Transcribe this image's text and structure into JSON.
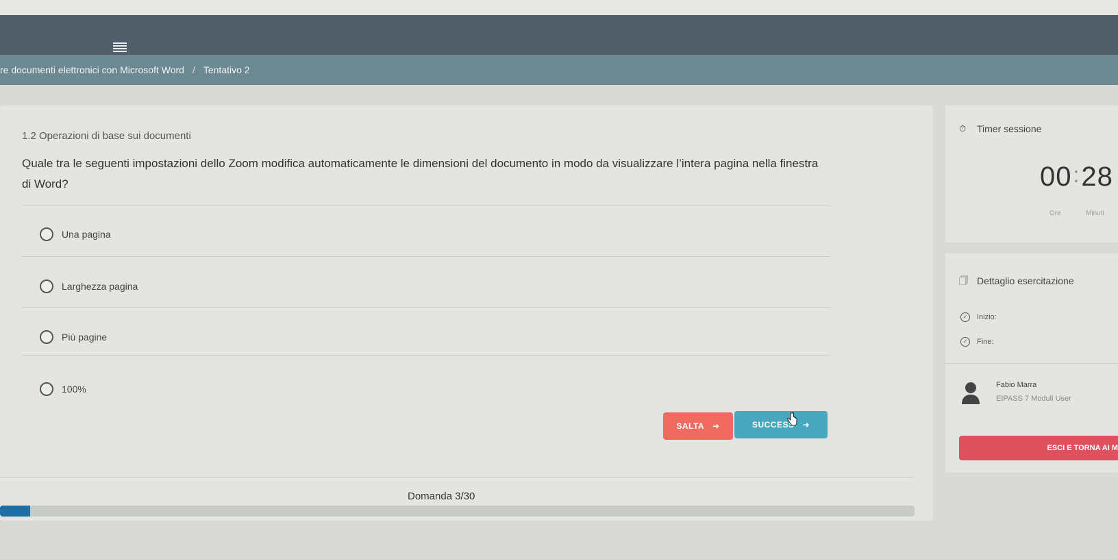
{
  "breadcrumb": {
    "course": "re documenti elettronici con Microsoft Word",
    "separator": "/",
    "attempt": "Tentativo 2"
  },
  "question": {
    "section": "1.2 Operazioni di base sui documenti",
    "text": "Quale tra le seguenti impostazioni dello Zoom modifica automaticamente le dimensioni del documento in modo da visualizzare l’intera pagina nella finestra di Word?",
    "options": [
      {
        "label": "Una pagina"
      },
      {
        "label": "Larghezza pagina"
      },
      {
        "label": "Più pagine"
      },
      {
        "label": "100%"
      }
    ]
  },
  "actions": {
    "skip_label": "SALTA",
    "next_label": "SUCCESS",
    "arrow": "➜"
  },
  "footer": {
    "counter": "Domanda 3/30",
    "progress_fraction": 0.033
  },
  "timer": {
    "title": "Timer sessione",
    "hours": "00",
    "colon": ":",
    "minutes": "28",
    "hours_label": "Ore",
    "minutes_label": "Minuti"
  },
  "detail": {
    "title": "Dettaglio esercitazione",
    "start_label": "Inizio:",
    "end_label": "Fine:"
  },
  "user": {
    "name": "Fabio Marra",
    "role": "EIPASS 7 Moduli User"
  },
  "exit_label": "ESCI E TORNA AI M",
  "colors": {
    "navbar": "#515d68",
    "breadcrumb": "#6c8891",
    "skip": "#ef6a61",
    "next": "#48a8bf",
    "exit": "#e0515f",
    "progress": "#1e6fa5"
  }
}
